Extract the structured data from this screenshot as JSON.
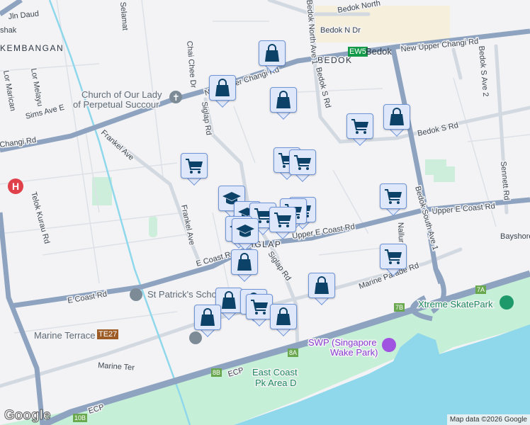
{
  "map": {
    "areas": {
      "bedok": "BEDOK",
      "kembangan": "KEMBANGAN",
      "siglap": "SIGLAP"
    },
    "streets": {
      "jln_daud": "Jln Daud",
      "ishak": "shak",
      "lor_marican": "Lor Marican",
      "lor_melayu": "Lor Melayu",
      "sims_ave_e": "Sims Ave E",
      "changi_rd": "Changi Rd",
      "frankel_ave_1": "Frankel Ave",
      "frankel_ave_2": "Frankel Ave",
      "chai_chee_dr": "Chai Chee Dr",
      "siglap_rd_1": "Siglap Rd",
      "siglap_rd_2": "Siglap Rd",
      "selamat": "Selamat",
      "new_upper_changi_rd_1": "New Upper Changi Rd",
      "new_upper_changi_rd_2": "New Upper Changi Rd",
      "bedok_north_ave_1": "Bedok North Ave 1",
      "bedok_n_dr": "Bedok N Dr",
      "bedok_north": "Bedok North",
      "bedok_s_rd_1": "Bedok S Rd",
      "bedok_s_rd_2": "Bedok S Rd",
      "bedok_s_ave_2": "Bedok S Ave 2",
      "sennett_rd": "Sennett Rd",
      "upper_e_coast_rd_1": "Upper E Coast Rd",
      "upper_e_coast_rd_2": "Upper E Coast Rd",
      "bedok_south_ave_1": "Bedok South Ave 1",
      "nallur": "Nallur",
      "marine_parade_rd": "Marine Parade Rd",
      "e_coast_rd_1": "E Coast Rd",
      "e_coast_rd_2": "E Coast Rd",
      "telok_kurau_rd": "Telok Kurau Rd",
      "marine_ter": "Marine Ter",
      "ecp_1": "ECP",
      "ecp_2": "ECP",
      "bayshore": "Bayshore"
    },
    "places": {
      "church": [
        "Church of Our Lady",
        "of Perpetual Succour"
      ],
      "st_patricks": "St Patrick's School",
      "marine_terrace": "Marine Terrace",
      "east_coast_park": [
        "East Coast",
        "Pk Area D"
      ],
      "swp": [
        "SWP (Singapore",
        "Wake Park)"
      ],
      "skatepark": "Xtreme SkatePark"
    },
    "stations": {
      "bedok_code": "EW5",
      "bedok_name": "Bedok",
      "marine_terrace_code": "TE27"
    },
    "exits": {
      "e8b": "8B",
      "e10b": "10B",
      "e8a": "8A",
      "e7b": "7B",
      "e7a": "7A"
    },
    "attribution": "Map data ©2026 Google",
    "logo": "Google",
    "colors": {
      "water": "#8fd8ec",
      "park": "#c6efd7",
      "highway": "#8ea3bf",
      "marker_icon": "#0d4268",
      "ew_line": "#129a48",
      "te_line": "#9d5b25"
    }
  }
}
